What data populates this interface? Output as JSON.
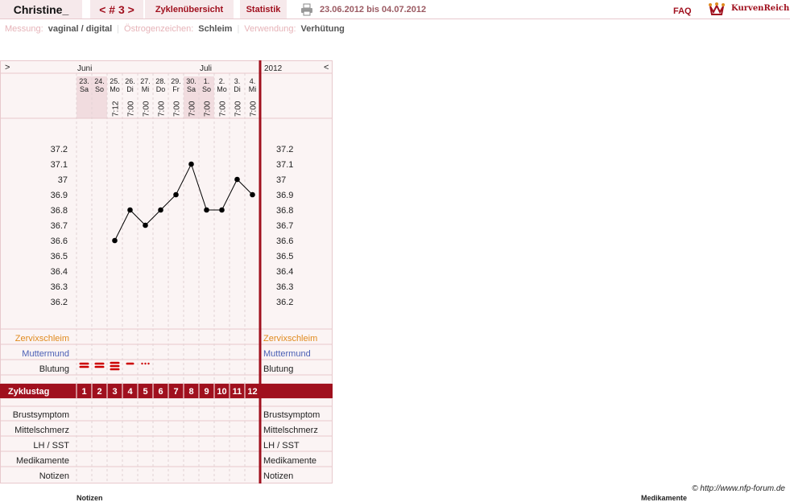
{
  "header": {
    "user_name": "Christine_",
    "cycle_prev": "<",
    "cycle_label": "# 3",
    "cycle_next": ">",
    "tab_overview": "Zyklenübersicht",
    "tab_stats": "Statistik",
    "date_range": "23.06.2012 bis 04.07.2012",
    "faq": "FAQ",
    "logo": "KurvenReich",
    "print_icon": "printer-icon"
  },
  "settings": {
    "measure_label": "Messung:",
    "measure_value": "vaginal / digital",
    "sign_label": "Östrogenzeichen:",
    "sign_value": "Schleim",
    "use_label": "Verwendung:",
    "use_value": "Verhütung"
  },
  "chart_data": {
    "type": "line",
    "nav_left": ">",
    "nav_right": "<",
    "year": "2012",
    "months": [
      "Juni",
      "Juli"
    ],
    "days": [
      {
        "date": "23.",
        "weekday": "Sa",
        "time": ""
      },
      {
        "date": "24.",
        "weekday": "So",
        "time": ""
      },
      {
        "date": "25.",
        "weekday": "Mo",
        "time": "7:12"
      },
      {
        "date": "26.",
        "weekday": "Di",
        "time": "7:00"
      },
      {
        "date": "27.",
        "weekday": "Mi",
        "time": "7:00"
      },
      {
        "date": "28.",
        "weekday": "Do",
        "time": "7:00"
      },
      {
        "date": "29.",
        "weekday": "Fr",
        "time": "7:00"
      },
      {
        "date": "30.",
        "weekday": "Sa",
        "time": "7:00"
      },
      {
        "date": "1.",
        "weekday": "So",
        "time": "7:00"
      },
      {
        "date": "2.",
        "weekday": "Mo",
        "time": "7:00"
      },
      {
        "date": "3.",
        "weekday": "Di",
        "time": "7:00"
      },
      {
        "date": "4.",
        "weekday": "Mi",
        "time": "7:00"
      }
    ],
    "y_ticks": [
      "37.2",
      "37.1",
      "37",
      "36.9",
      "36.8",
      "36.7",
      "36.6",
      "36.5",
      "36.4",
      "36.3",
      "36.2"
    ],
    "ylim": [
      36.2,
      37.2
    ],
    "temperatures": [
      null,
      null,
      36.6,
      36.8,
      36.7,
      36.8,
      36.9,
      37.1,
      36.8,
      36.8,
      37.0,
      36.9
    ],
    "bleeding": [
      "double",
      "double",
      "triple",
      "single",
      "dots",
      null,
      null,
      null,
      null,
      null,
      null,
      null
    ],
    "row_labels": {
      "mucus": "Zervixschleim",
      "cervix": "Muttermund",
      "bleeding": "Blutung",
      "cycle_day": "Zyklustag",
      "breast": "Brustsymptom",
      "midpain": "Mittelschmerz",
      "lh": "LH / SST",
      "meds": "Medikamente",
      "notes": "Notizen"
    },
    "cycle_days": [
      "1",
      "2",
      "3",
      "4",
      "5",
      "6",
      "7",
      "8",
      "9",
      "10",
      "11",
      "12"
    ],
    "colors": {
      "accent": "#a0101e",
      "mucus": "#e08a1e",
      "cervix": "#4a5fb5",
      "line": "#000000"
    }
  },
  "footer": {
    "copyright": "© http://www.nfp-forum.de",
    "notes_heading": "Notizen",
    "meds_heading": "Medikamente"
  }
}
